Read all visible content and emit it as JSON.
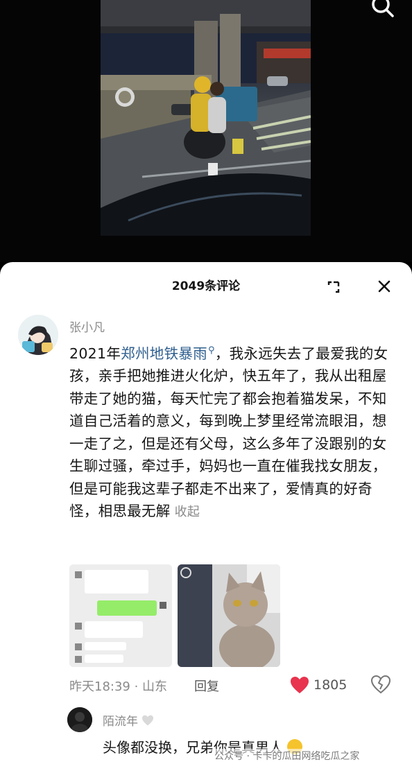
{
  "comments_header": {
    "title": "2049条评论"
  },
  "comment": {
    "username": "张小凡",
    "text_prefix": "2021年",
    "hashtag": "郑州地铁暴雨",
    "text_main": "，我永远失去了最爱我的女孩，亲手把她推进火化炉，快五年了，我从出租屋带走了她的猫，每天忙完了都会抱着猫发呆，不知道自己活着的意义，每到晚上梦里经常流眼泪，想一走了之，但是还有父母，这么多年了没跟别的女生聊过骚，牵过手，妈妈也一直在催我找女朋友，但是可能我这辈子都走不出来了，爱情真的好奇怪，相思最无解",
    "collapse_label": "收起",
    "time_location": "昨天18:39 · 山东",
    "reply_label": "回复",
    "like_count": "1805"
  },
  "reply": {
    "username": "陌流年",
    "text": "头像都没换，兄弟你是真男人"
  },
  "watermark": "公众号 · 卡卡的瓜田网络吃瓜之家",
  "icons": {
    "search": "search-icon",
    "expand": "expand-icon",
    "close": "close-icon",
    "like": "heart-icon",
    "dislike": "broken-heart-icon",
    "username_badge": "heart-outline-icon"
  },
  "colors": {
    "accent": "#2f5f8f",
    "like": "#e8344e",
    "muted": "#8a8a8a"
  }
}
